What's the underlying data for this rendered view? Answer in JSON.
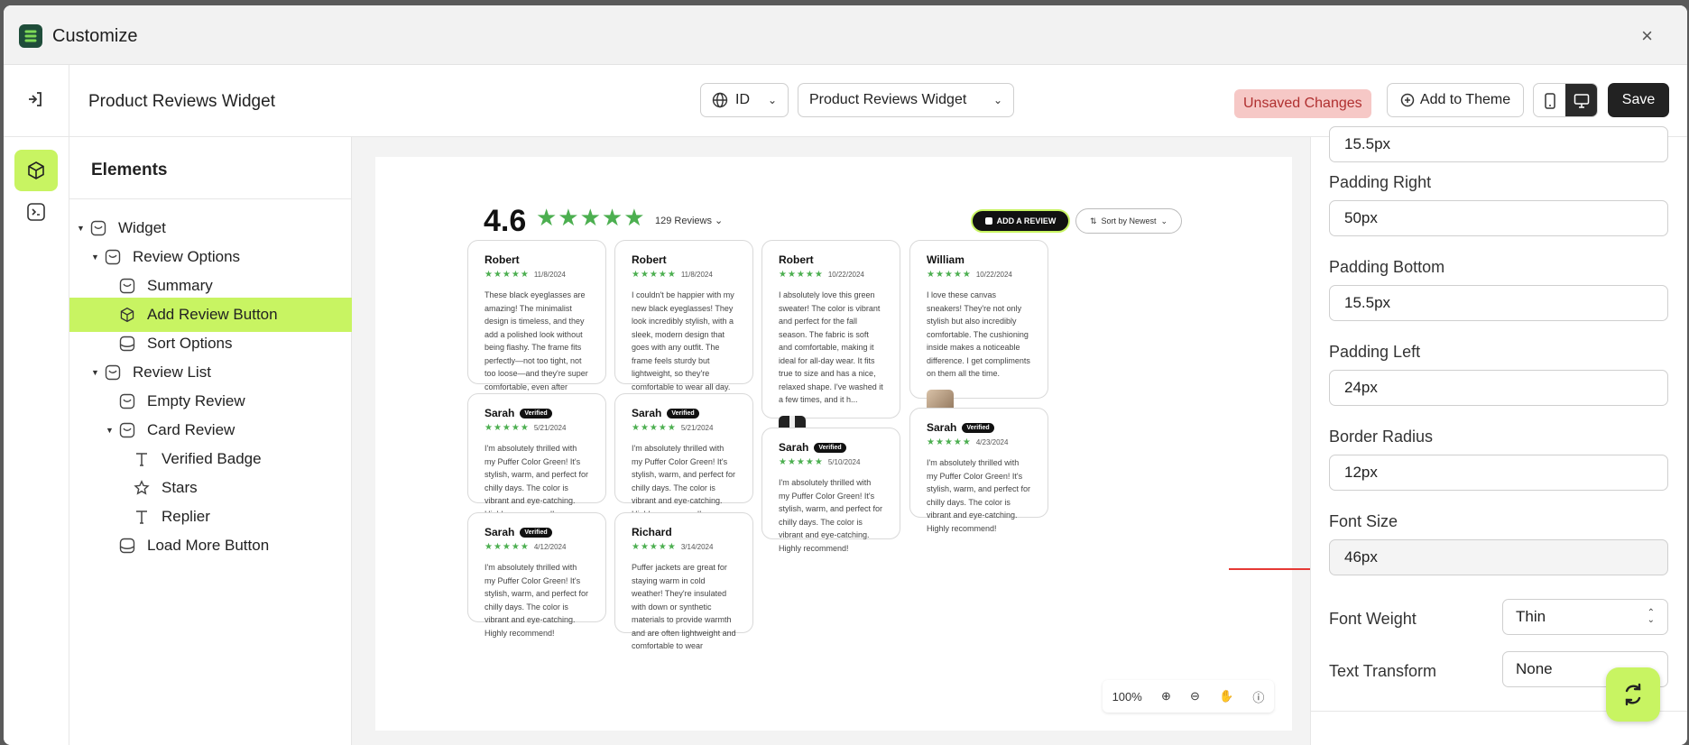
{
  "app": {
    "title": "Customize",
    "close_glyph": "×"
  },
  "toolbar": {
    "page_name": "Product Reviews Widget",
    "language": "ID",
    "widget_select": "Product Reviews Widget",
    "unsaved_label": "Unsaved Changes",
    "add_theme_label": "Add to Theme",
    "save_label": "Save"
  },
  "elements_panel": {
    "heading": "Elements",
    "items": [
      {
        "label": "Widget",
        "icon": "widget-icon"
      },
      {
        "label": "Review Options",
        "icon": "section-icon"
      },
      {
        "label": "Summary",
        "icon": "section-icon"
      },
      {
        "label": "Add Review Button",
        "icon": "cube-icon",
        "selected": true
      },
      {
        "label": "Sort Options",
        "icon": "box-icon"
      },
      {
        "label": "Review List",
        "icon": "section-icon"
      },
      {
        "label": "Empty Review",
        "icon": "section-icon"
      },
      {
        "label": "Card Review",
        "icon": "section-icon"
      },
      {
        "label": "Verified Badge",
        "icon": "text-icon"
      },
      {
        "label": "Stars",
        "icon": "star-icon"
      },
      {
        "label": "Replier",
        "icon": "text-icon"
      },
      {
        "label": "Load More Button",
        "icon": "box-icon"
      }
    ]
  },
  "preview": {
    "rating": "4.6",
    "stars": "★★★★★",
    "review_count": "129 Reviews",
    "add_review_label": "ADD A REVIEW",
    "sort_label": "Sort by Newest",
    "card_stars": "★★★★★",
    "verified": "Verified",
    "cards": [
      {
        "name": "Robert",
        "date": "11/8/2024",
        "verified": false,
        "text": "These black eyeglasses are amazing! The minimalist design is timeless, and they add a polished look without being flashy. The frame fits perfectly—not too tight, not too loose—and they're super comfortable, even after wearing them for hours. The qual..."
      },
      {
        "name": "Robert",
        "date": "11/8/2024",
        "verified": false,
        "text": "I couldn't be happier with my new black eyeglasses! They look incredibly stylish, with a sleek, modern design that goes with any outfit. The frame feels sturdy but lightweight, so they're comfortable to wear all day. The lenses offer clear vision wit..."
      },
      {
        "name": "Robert",
        "date": "10/22/2024",
        "verified": false,
        "text": "I absolutely love this green sweater! The color is vibrant and perfect for the fall season. The fabric is soft and comfortable, making it ideal for all-day wear. It fits true to size and has a nice, relaxed shape. I've washed it a few times, and it h..."
      },
      {
        "name": "William",
        "date": "10/22/2024",
        "verified": false,
        "text": "I love these canvas sneakers! They're not only stylish but also incredibly comfortable. The cushioning inside makes a noticeable difference. I get compliments on them all the time."
      },
      {
        "name": "Sarah",
        "date": "5/21/2024",
        "verified": true,
        "text": "I'm absolutely thrilled with my Puffer Color Green! It's stylish, warm, and perfect for chilly days. The color is vibrant and eye-catching. Highly recommend!"
      },
      {
        "name": "Sarah",
        "date": "5/21/2024",
        "verified": true,
        "text": "I'm absolutely thrilled with my Puffer Color Green! It's stylish, warm, and perfect for chilly days. The color is vibrant and eye-catching. Highly recommend!"
      },
      {
        "name": "Sarah",
        "date": "5/10/2024",
        "verified": true,
        "text": "I'm absolutely thrilled with my Puffer Color Green! It's stylish, warm, and perfect for chilly days. The color is vibrant and eye-catching. Highly recommend!"
      },
      {
        "name": "Sarah",
        "date": "4/23/2024",
        "verified": true,
        "text": "I'm absolutely thrilled with my Puffer Color Green! It's stylish, warm, and perfect for chilly days. The color is vibrant and eye-catching. Highly recommend!"
      },
      {
        "name": "Sarah",
        "date": "4/12/2024",
        "verified": true,
        "text": "I'm absolutely thrilled with my Puffer Color Green! It's stylish, warm, and perfect for chilly days. The color is vibrant and eye-catching. Highly recommend!"
      },
      {
        "name": "Richard",
        "date": "3/14/2024",
        "verified": false,
        "text": "Puffer jackets are great for staying warm in cold weather! They're insulated with down or synthetic materials to provide warmth and are often lightweight and comfortable to wear"
      }
    ],
    "zoom_level": "100%"
  },
  "properties": {
    "fields": [
      {
        "label": "",
        "value": "15.5px"
      },
      {
        "label": "Padding Right",
        "value": "50px"
      },
      {
        "label": "Padding Bottom",
        "value": "15.5px"
      },
      {
        "label": "Padding Left",
        "value": "24px"
      },
      {
        "label": "Border Radius",
        "value": "12px"
      },
      {
        "label": "Font Size",
        "value": "46px"
      }
    ],
    "font_weight_label": "Font Weight",
    "font_weight_value": "Thin",
    "text_transform_label": "Text Transform",
    "text_transform_value": "None"
  },
  "colors": {
    "accent": "#c8f462",
    "star": "#4caf50",
    "danger_bg": "#f6c8c6",
    "arrow": "#e53935"
  }
}
